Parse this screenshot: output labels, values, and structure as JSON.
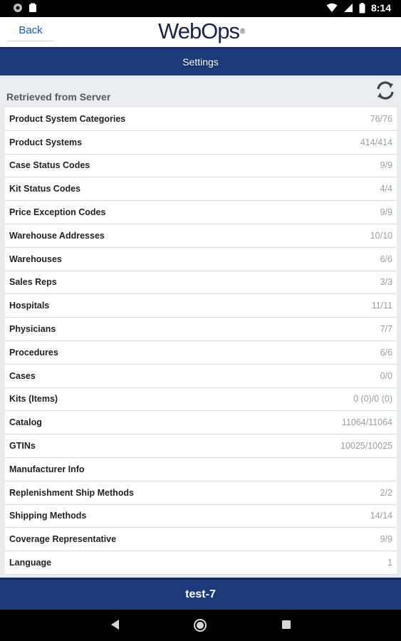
{
  "status_bar": {
    "time": "8:14"
  },
  "header": {
    "back_label": "Back",
    "logo_text": "WebOps",
    "logo_mark": "®"
  },
  "title_bar": {
    "title": "Settings"
  },
  "section": {
    "label": "Retrieved from Server"
  },
  "rows": [
    {
      "name": "Product System Categories",
      "value": "76/76"
    },
    {
      "name": "Product Systems",
      "value": "414/414"
    },
    {
      "name": "Case Status Codes",
      "value": "9/9"
    },
    {
      "name": "Kit Status Codes",
      "value": "4/4"
    },
    {
      "name": "Price Exception Codes",
      "value": "9/9"
    },
    {
      "name": "Warehouse Addresses",
      "value": "10/10"
    },
    {
      "name": "Warehouses",
      "value": "6/6"
    },
    {
      "name": "Sales Reps",
      "value": "3/3"
    },
    {
      "name": "Hospitals",
      "value": "11/11"
    },
    {
      "name": "Physicians",
      "value": "7/7"
    },
    {
      "name": "Procedures",
      "value": "6/6"
    },
    {
      "name": "Cases",
      "value": "0/0"
    },
    {
      "name": "Kits (Items)",
      "value": "0 (0)/0 (0)"
    },
    {
      "name": "Catalog",
      "value": "11064/11064"
    },
    {
      "name": "GTINs",
      "value": "10025/10025"
    },
    {
      "name": "Manufacturer Info",
      "value": ""
    },
    {
      "name": "Replenishment Ship Methods",
      "value": "2/2"
    },
    {
      "name": "Shipping Methods",
      "value": "14/14"
    },
    {
      "name": "Coverage Representative",
      "value": "9/9"
    },
    {
      "name": "Language",
      "value": "1"
    }
  ],
  "footer": {
    "label": "test-7"
  },
  "colors": {
    "brand_navy": "#1c3a7a",
    "link_blue": "#1a5bc7"
  },
  "icons": [
    "circle-icon",
    "clipboard-icon",
    "wifi-icon",
    "signal-icon",
    "battery-icon",
    "refresh-icon",
    "back-triangle-icon",
    "home-circle-icon",
    "recents-square-icon"
  ]
}
